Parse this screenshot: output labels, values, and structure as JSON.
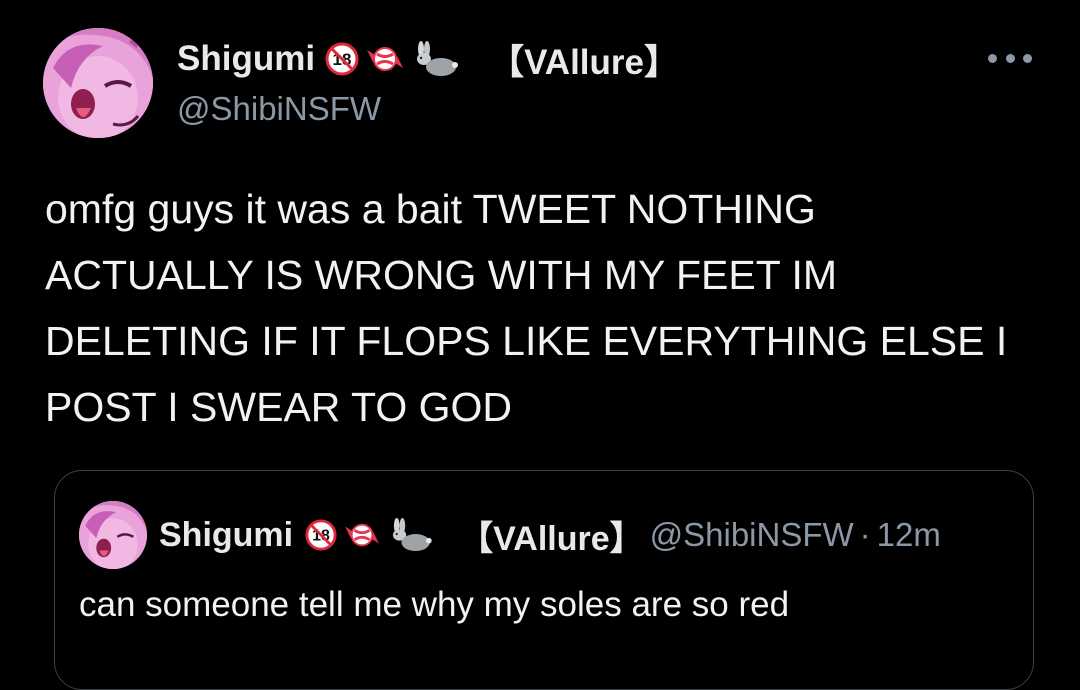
{
  "tweet": {
    "author": {
      "display_name": "Shigumi",
      "name_tag": "【VAllure】",
      "handle": "@ShibiNSFW",
      "emojis": [
        "no-one-under-18-icon",
        "candy-icon",
        "rabbit-icon"
      ]
    },
    "text_lines": [
      "omfg guys it was a bait TWEET NOTHING",
      "ACTUALLY IS WRONG WITH MY FEET IM",
      "DELETING IF IT FLOPS LIKE EVERYTHING ELSE I",
      "POST I SWEAR TO GOD"
    ],
    "more_icon": "more-horizontal-icon"
  },
  "quote": {
    "author": {
      "display_name": "Shigumi",
      "name_tag": "【VAllure】",
      "handle": "@ShibiNSFW",
      "separator": "·",
      "time": "12m"
    },
    "text": "can someone tell me why my soles are so red"
  },
  "colors": {
    "background": "#000000",
    "text": "#e7e9ea",
    "secondary_text": "#8b98a5",
    "border": "#3a3f44"
  }
}
